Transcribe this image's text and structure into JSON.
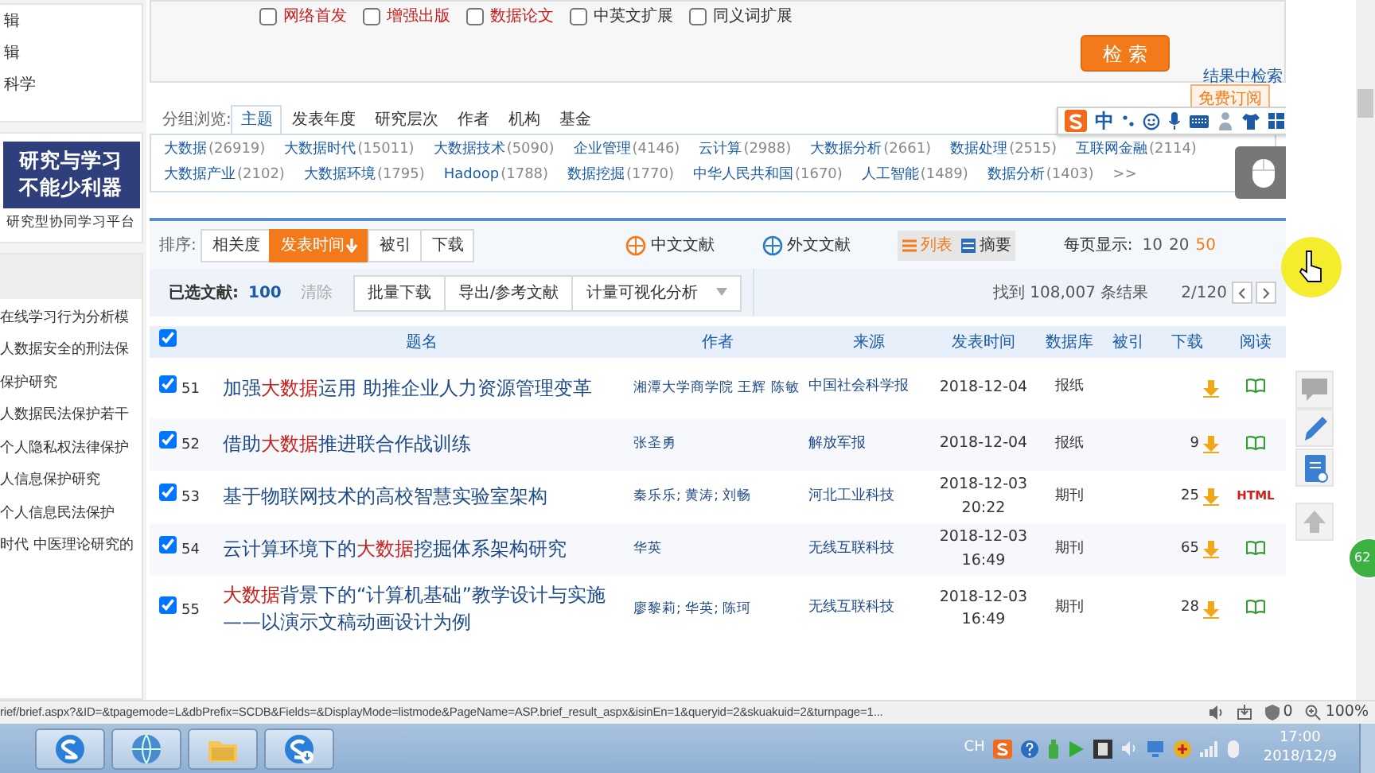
{
  "search_options": [
    {
      "label": "网络首发",
      "checked": false,
      "highlight": true
    },
    {
      "label": "增强出版",
      "checked": false,
      "highlight": true
    },
    {
      "label": "数据论文",
      "checked": false,
      "highlight": true
    },
    {
      "label": "中英文扩展",
      "checked": false,
      "highlight": false
    },
    {
      "label": "同义词扩展",
      "checked": false,
      "highlight": false
    }
  ],
  "search_button": "检 索",
  "refine_link": "结果中检索",
  "sidebar": {
    "top_items": [
      "辑",
      "辑",
      "科学"
    ],
    "banner": {
      "lines": [
        "研究与学习",
        "不能少利器"
      ],
      "caption": "研究型协同学习平台"
    },
    "recent": [
      "在线学习行为分析模",
      "人数据安全的刑法保",
      "保护研究",
      "人数据民法保护若干",
      "个人隐私权法律保护",
      "人信息保护研究",
      "个人信息民法保护",
      "时代 中医理论研究的"
    ]
  },
  "group_browse": {
    "label": "分组浏览:",
    "subscribe": "免费订阅",
    "tabs": [
      {
        "label": "主题",
        "selected": true
      },
      {
        "label": "发表年度",
        "selected": false
      },
      {
        "label": "研究层次",
        "selected": false
      },
      {
        "label": "作者",
        "selected": false
      },
      {
        "label": "机构",
        "selected": false
      },
      {
        "label": "基金",
        "selected": false
      }
    ],
    "topics": [
      {
        "name": "大数据",
        "count": "(26919)"
      },
      {
        "name": "大数据时代",
        "count": "(15011)"
      },
      {
        "name": "大数据技术",
        "count": "(5090)"
      },
      {
        "name": "企业管理",
        "count": "(4146)"
      },
      {
        "name": "云计算",
        "count": "(2988)"
      },
      {
        "name": "大数据分析",
        "count": "(2661)"
      },
      {
        "name": "数据处理",
        "count": "(2515)"
      },
      {
        "name": "互联网金融",
        "count": "(2114)"
      },
      {
        "name": "大数据产业",
        "count": "(2102)"
      },
      {
        "name": "大数据环境",
        "count": "(1795)"
      },
      {
        "name": "Hadoop",
        "count": "(1788)"
      },
      {
        "name": "数据挖掘",
        "count": "(1770)"
      },
      {
        "name": "中华人民共和国",
        "count": "(1670)"
      },
      {
        "name": "人工智能",
        "count": "(1489)"
      },
      {
        "name": "数据分析",
        "count": "(1403)"
      }
    ],
    "more": ">>"
  },
  "ime_bar": {
    "mode": "中"
  },
  "sort": {
    "label": "排序:",
    "options": [
      {
        "label": "相关度",
        "selected": false
      },
      {
        "label": "发表时间",
        "selected": true
      },
      {
        "label": "被引",
        "selected": false
      },
      {
        "label": "下载",
        "selected": false
      }
    ],
    "lang_filters": [
      "中文文献",
      "外文文献"
    ],
    "views": [
      {
        "label": "列表",
        "selected": true
      },
      {
        "label": "摘要",
        "selected": false
      }
    ],
    "per_page_label": "每页显示:",
    "per_page": [
      {
        "label": "10",
        "selected": false
      },
      {
        "label": "20",
        "selected": false
      },
      {
        "label": "50",
        "selected": true
      }
    ]
  },
  "toolbar": {
    "selected_label": "已选文献:",
    "selected_count": "100",
    "clear": "清除",
    "actions": [
      "批量下载",
      "导出/参考文献",
      "计量可视化分析"
    ],
    "result_count": "找到 108,007 条结果",
    "page": "2/120"
  },
  "table": {
    "all_checked": true,
    "columns": [
      "题名",
      "作者",
      "来源",
      "发表时间",
      "数据库",
      "被引",
      "下载",
      "阅读"
    ],
    "rows": [
      {
        "checked": true,
        "no": "51",
        "title": "加强**大数据**运用  助推企业人力资源管理变革",
        "author": "湘潭大学商学院 王辉 陈敏",
        "source": "中国社会科学报",
        "date": "2018-12-04",
        "time": "",
        "db": "报纸",
        "downloads": "",
        "reader": {
          "kind": "book"
        }
      },
      {
        "checked": true,
        "no": "52",
        "title": "借助**大数据**推进联合作战训练",
        "author": "张圣勇",
        "source": "解放军报",
        "date": "2018-12-04",
        "time": "",
        "db": "报纸",
        "downloads": "9",
        "reader": {
          "kind": "book"
        }
      },
      {
        "checked": true,
        "no": "53",
        "title": "基于物联网技术的高校智慧实验室架构",
        "author": "秦乐乐; 黄涛; 刘畅",
        "source": "河北工业科技",
        "date": "2018-12-03",
        "time": "20:22",
        "db": "期刊",
        "downloads": "25",
        "reader": {
          "kind": "html",
          "label": "HTML"
        }
      },
      {
        "checked": true,
        "no": "54",
        "title": "云计算环境下的**大数据**挖掘体系架构研究",
        "author": "华英",
        "source": "无线互联科技",
        "date": "2018-12-03",
        "time": "16:49",
        "db": "期刊",
        "downloads": "65",
        "reader": {
          "kind": "book"
        }
      },
      {
        "checked": true,
        "no": "55",
        "title": "**大数据**背景下的“计算机基础”教学设计与实施——以演示文稿动画设计为例",
        "author": "廖黎莉; 华英; 陈珂",
        "source": "无线互联科技",
        "date": "2018-12-03",
        "time": "16:49",
        "db": "期刊",
        "downloads": "28",
        "reader": {
          "kind": "book"
        }
      }
    ]
  },
  "side_badge": "62",
  "status_bar": {
    "url": "rief/brief.aspx?&ID=&tpagemode=L&dbPrefix=SCDB&Fields=&DisplayMode=listmode&PageName=ASP.brief_result_aspx&isinEn=1&queryid=2&skuakuid=2&turnpage=1...",
    "count": "0",
    "zoom": "100%"
  },
  "taskbar": {
    "lang": "CH",
    "time": "17:00",
    "date": "2018/12/9"
  }
}
